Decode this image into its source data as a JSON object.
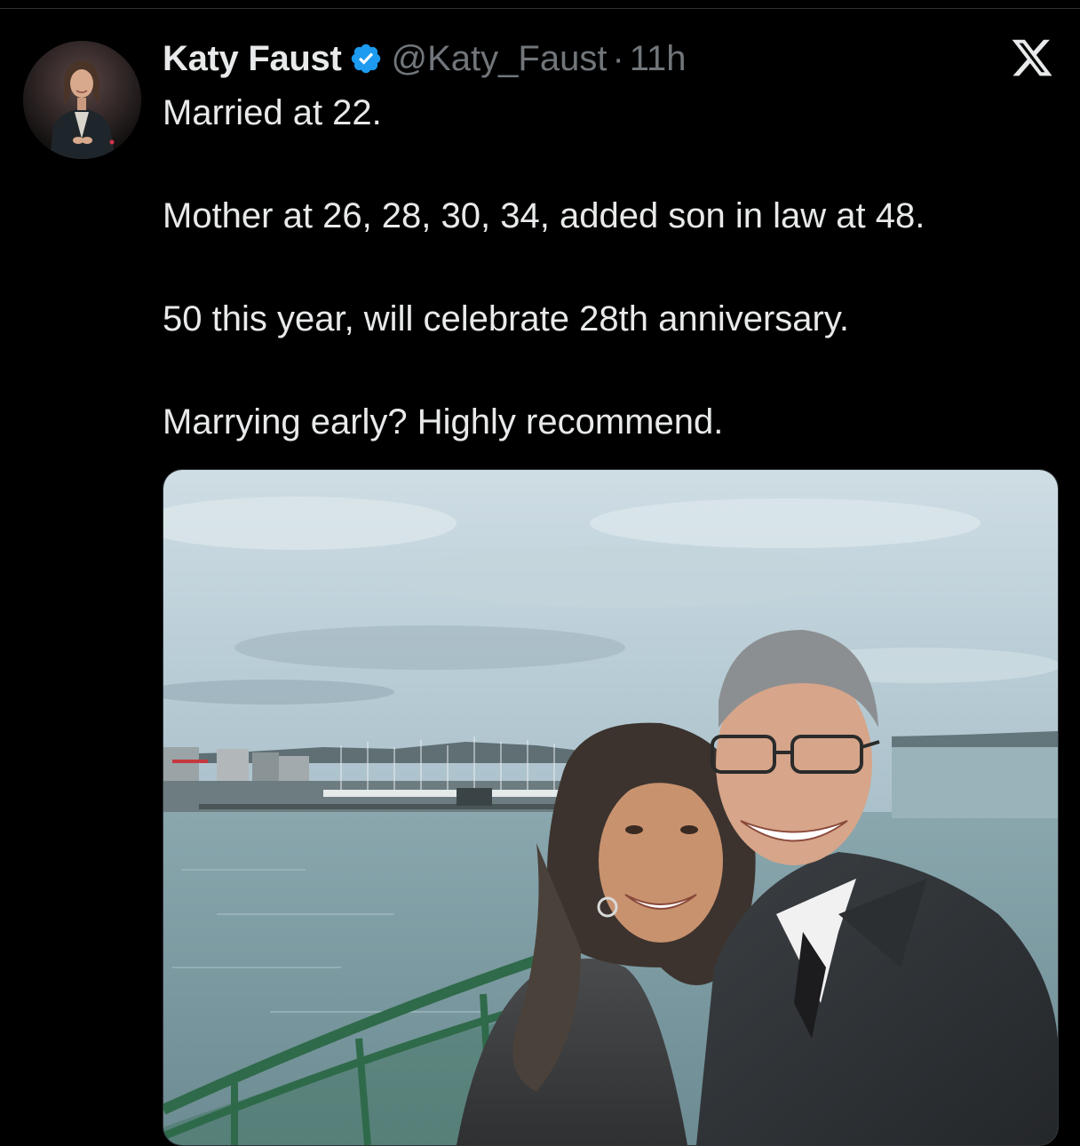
{
  "tweet": {
    "author": {
      "display_name": "Katy Faust",
      "handle": "@Katy_Faust",
      "verified": true
    },
    "separator": "·",
    "timestamp": "11h",
    "text": {
      "line1": "Married at 22.",
      "line2": "Mother at 26, 28, 30, 34, added son in law at 48.",
      "line3": "50 this year, will celebrate 28th anniversary.",
      "line4": "Marrying early? Highly recommend."
    },
    "media": {
      "type": "photo",
      "scene": "selfie-on-ferry-deck"
    }
  },
  "icons": {
    "verified": "verified-badge-icon",
    "brand": "x-logo-icon"
  },
  "colors": {
    "background": "#000000",
    "primary_text": "#e7e9ea",
    "secondary_text": "#71767b",
    "verified_blue": "#1d9bf0",
    "divider": "#2f3336"
  }
}
